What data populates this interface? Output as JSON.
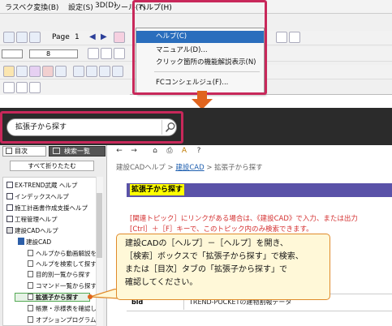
{
  "menubar": {
    "items": [
      "ラスベク変換(B)",
      "設定(S)",
      "3D(D)",
      "ツール(T)",
      "ヘルプ(H)"
    ]
  },
  "toolbar1": {
    "page_label": "Page",
    "page_number": "1"
  },
  "toolbar2": {
    "line_width_value": "8"
  },
  "help_dropdown": {
    "items": [
      "ヘルプ(C)",
      "マニュアル(D)...",
      "クリック箇所の機能解説表示(N)",
      "FCコンシェルジュ(F)..."
    ]
  },
  "search": {
    "value": "拡張子から探す"
  },
  "left_panel": {
    "tab_toc": "目次",
    "tab_search": "検索一覧",
    "collapse_button": "すべて折りたたむ",
    "toc_items": [
      "EX-TREND武蔵 ヘルプ",
      "インデックスヘルプ",
      "施工計画書作成支援ヘルプ",
      "工程管理ヘルプ",
      "建設CADヘルプ",
      "建設CAD",
      "ヘルプから動画解説を",
      "ヘルプを検索して探す",
      "目的別一覧から探す",
      "コマンド一覧から探す",
      "拡張子から探す",
      "帳票・示様表を確認し",
      "オプションプログラム"
    ]
  },
  "content": {
    "breadcrumb_root": "建設CADヘルプ",
    "breadcrumb_sep": ">",
    "breadcrumb_link": "建設CAD",
    "breadcrumb_current": "拡張子から探す",
    "title": "拡張子から探す",
    "related_line1": "[関連トピック］にリンクがある場合は、《建設CAD》で入力、または出力",
    "related_line2": "[Ctrl］＋［F］キーで、このトピック内のみ検索できます。",
    "table_ext": "bld",
    "table_desc": "TREND-POCKETの建物割報データ"
  },
  "callout": {
    "lines": [
      "建設CADの［ヘルプ］－［ヘルプ］を開き、",
      "［検索］ボックスで「拡張子から探す」で検索、",
      "または［目次］タブの「拡張子から探す」で",
      "確認してください。"
    ]
  },
  "colors": {
    "highlight_outline": "#c8285a",
    "arrow": "#e0641e",
    "selected_menu": "#2a6ebd",
    "title_bar": "#5a52a8",
    "title_highlight": "#ffff00",
    "related_text": "#d43030",
    "callout_border": "#e08a2a"
  },
  "icons": {
    "search": "search-icon",
    "back": "back-arrow-icon",
    "forward": "forward-arrow-icon",
    "home": "home-icon",
    "print": "print-icon",
    "font": "font-size-icon",
    "help": "question-icon"
  }
}
